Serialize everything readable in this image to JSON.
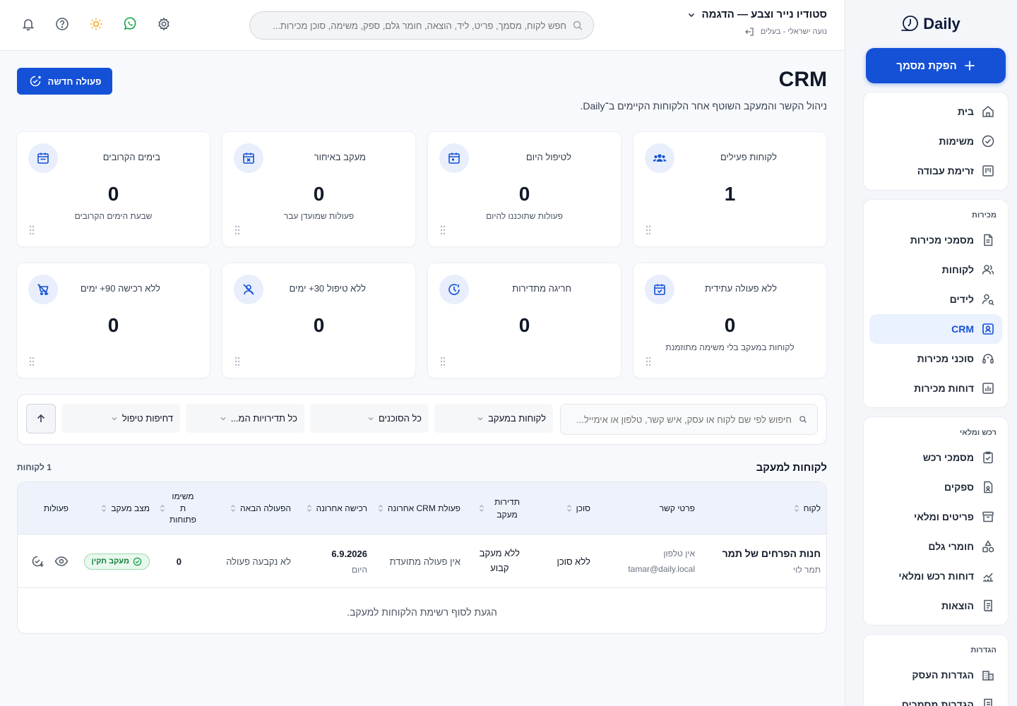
{
  "app": {
    "logo_text": "Daily"
  },
  "sidebar": {
    "cta_label": "הפקת מסמך",
    "groups": [
      {
        "title": "",
        "items": [
          {
            "label": "בית",
            "icon": "home-icon"
          },
          {
            "label": "משימות",
            "icon": "check-circle-icon"
          },
          {
            "label": "זרימת עבודה",
            "icon": "kanban-icon"
          }
        ]
      },
      {
        "title": "מכירות",
        "items": [
          {
            "label": "מסמכי מכירות",
            "icon": "document-icon"
          },
          {
            "label": "לקוחות",
            "icon": "users-icon"
          },
          {
            "label": "לידים",
            "icon": "user-search-icon"
          },
          {
            "label": "CRM",
            "icon": "contact-card-icon",
            "active": true
          },
          {
            "label": "סוכני מכירות",
            "icon": "headset-icon"
          },
          {
            "label": "דוחות מכירות",
            "icon": "bar-chart-icon"
          }
        ]
      },
      {
        "title": "רכש ומלאי",
        "items": [
          {
            "label": "מסמכי רכש",
            "icon": "clipboard-check-icon"
          },
          {
            "label": "ספקים",
            "icon": "supplier-file-icon"
          },
          {
            "label": "פריטים ומלאי",
            "icon": "archive-box-icon"
          },
          {
            "label": "חומרי גלם",
            "icon": "shapes-icon"
          },
          {
            "label": "דוחות רכש ומלאי",
            "icon": "line-chart-icon"
          },
          {
            "label": "הוצאות",
            "icon": "receipt-icon"
          }
        ]
      },
      {
        "title": "הגדרות",
        "items": [
          {
            "label": "הגדרות העסק",
            "icon": "building-icon"
          },
          {
            "label": "הגדרות מסמכים",
            "icon": "document-settings-icon"
          }
        ]
      }
    ]
  },
  "topbar": {
    "org_name": "סטודיו נייר וצבע — הדגמה",
    "user_name": "נועה ישראלי - בעלים",
    "search_placeholder": "חפש לקוח, מסמך, פריט, ליד, הוצאה, חומר גלם, ספק, משימה, סוכן מכירות..."
  },
  "page": {
    "title": "CRM",
    "subtitle": "ניהול הקשר והמעקב השוטף אחר הלקוחות הקיימים ב־Daily.",
    "new_action_label": "פעולה חדשה"
  },
  "stats": [
    {
      "label": "לקוחות פעילים",
      "value": "1",
      "desc": "",
      "icon": "users-group-icon"
    },
    {
      "label": "לטיפול היום",
      "value": "0",
      "desc": "פעולות שתוכננו להיום",
      "icon": "calendar-icon"
    },
    {
      "label": "מעקב באיחור",
      "value": "0",
      "desc": "פעולות שמועדן עבר",
      "icon": "calendar-x-icon"
    },
    {
      "label": "בימים הקרובים",
      "value": "0",
      "desc": "שבעת הימים הקרובים",
      "icon": "calendar-week-icon"
    },
    {
      "label": "ללא פעולה עתידית",
      "value": "0",
      "desc": "לקוחות במעקב בלי משימה מתוזמנת",
      "icon": "calendar-check-icon"
    },
    {
      "label": "חריגה מתדירות",
      "value": "0",
      "desc": "",
      "icon": "clock-alert-icon"
    },
    {
      "label": "ללא טיפול 30+ ימים",
      "value": "0",
      "desc": "",
      "icon": "user-off-icon"
    },
    {
      "label": "ללא רכישה 90+ ימים",
      "value": "0",
      "desc": "",
      "icon": "cart-off-icon"
    }
  ],
  "filters": {
    "search_placeholder": "חיפוש לפי שם לקוח או עסק, איש קשר, טלפון או אימייל...",
    "status_value": "לקוחות במעקב",
    "agent_value": "כל הסוכנים",
    "frequency_value": "כל תדירויות המ...",
    "priority_value": "דחיפות טיפול"
  },
  "list": {
    "title": "לקוחות למעקב",
    "count": "1 לקוחות",
    "columns": {
      "customer": "לקוח",
      "contact": "פרטי קשר",
      "agent": "סוכן",
      "frequency_1": "תדירות",
      "frequency_2": "מעקב",
      "last_crm": "פעולת CRM אחרונה",
      "last_purchase": "רכישה אחרונה",
      "next_action": "הפעולה הבאה",
      "open_tasks_1": "משימו",
      "open_tasks_2": "ת",
      "open_tasks_3": "פתוחות",
      "status": "מצב מעקב",
      "actions": "פעולות"
    },
    "rows": [
      {
        "customer": "חנות הפרחים של תמר",
        "contact_person": "תמר לוי",
        "phone": "אין טלפון",
        "email": "tamar@daily.local",
        "agent": "ללא סוכן",
        "frequency_1": "ללא מעקב",
        "frequency_2": "קבוע",
        "last_crm": "אין פעולה מתועדת",
        "last_purchase": "6.9.2026",
        "last_purchase_rel": "היום",
        "next_action": "לא נקבעה פעולה",
        "open_tasks": "0",
        "status": "מעקב תקין"
      }
    ],
    "end_message": "הגעת לסוף רשימת הלקוחות למעקב."
  }
}
